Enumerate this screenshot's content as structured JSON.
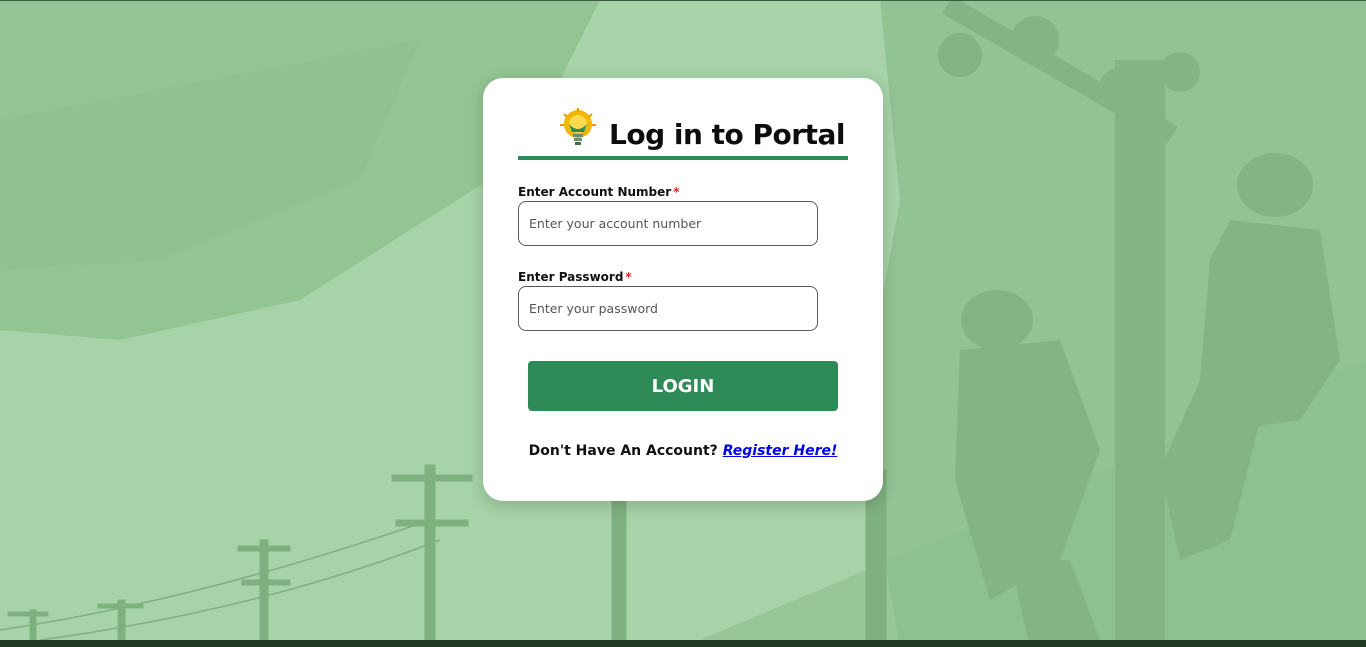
{
  "colors": {
    "background": "#a7d3a8",
    "accent": "#2e8b57",
    "required": "#e02424",
    "link": "#0000ee"
  },
  "login": {
    "logo_icon": "sun-bulb-logo-icon",
    "title": "Log in to Portal",
    "account": {
      "label": "Enter Account Number",
      "required_mark": "*",
      "placeholder": "Enter your account number",
      "value": ""
    },
    "password": {
      "label": "Enter Password",
      "required_mark": "*",
      "placeholder": "Enter your password",
      "value": ""
    },
    "submit_label": "LOGIN",
    "register_prompt": "Don't Have An Account?",
    "register_link": "Register Here!"
  }
}
